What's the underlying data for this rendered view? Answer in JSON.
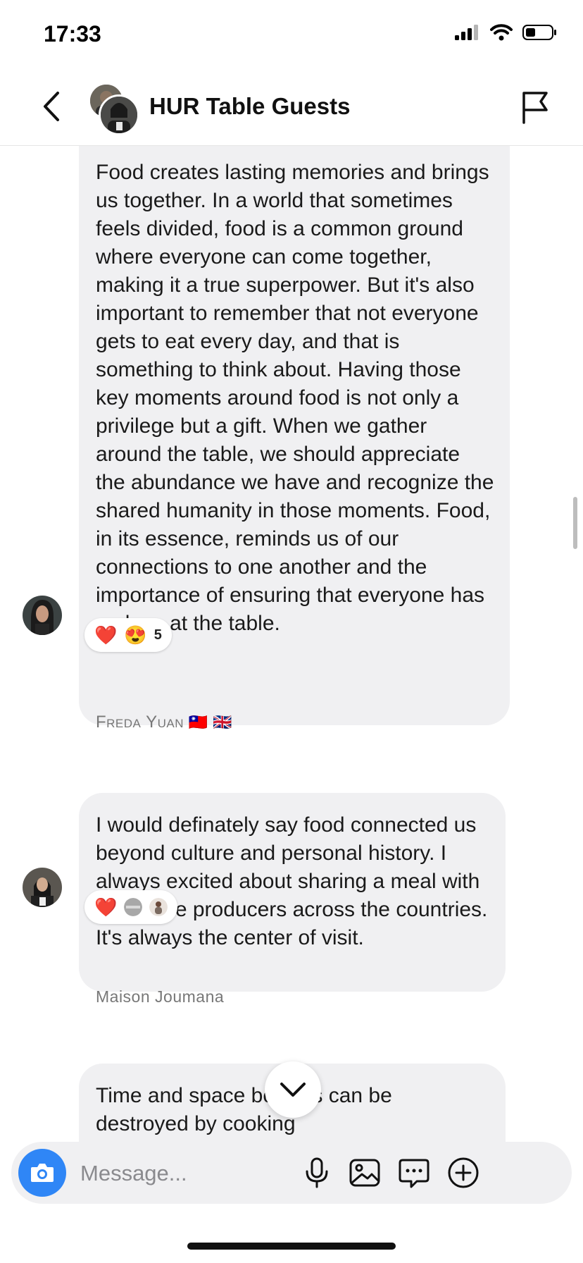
{
  "status_bar": {
    "time": "17:33"
  },
  "header": {
    "title": "HUR Table Guests"
  },
  "messages": [
    {
      "sender": "",
      "text": "Food creates lasting memories and brings us together. In a world that sometimes feels divided, food is a common ground where everyone can come together, making it a true superpower. But it's also important to remember that not everyone gets to eat every day, and that is something to think about. Having those key moments around food is not only a privilege but a gift. When we gather around the table, we should appreciate the abundance we have and recognize the shared humanity in those moments. Food, in its essence, reminds us of our connections to one another and the importance of ensuring that everyone has a place at the table.",
      "reactions": {
        "emojis": [
          "❤️",
          "😍"
        ],
        "count": "5"
      }
    },
    {
      "sender": "Freda Yuan",
      "sender_flags": "🇹🇼 🇬🇧",
      "text": "I would definately say food connected us beyond culture and personal history. I always excited about sharing a meal with my coffee producers across the countries. It's always the center of visit.",
      "reactions": {
        "emojis": [
          "❤️"
        ]
      }
    },
    {
      "sender": "Maison Joumana",
      "text": "Time and space borders can be destroyed by cooking"
    }
  ],
  "composer": {
    "placeholder": "Message..."
  },
  "colors": {
    "accent": "#2f86f6",
    "bubble": "#f0f0f2"
  }
}
